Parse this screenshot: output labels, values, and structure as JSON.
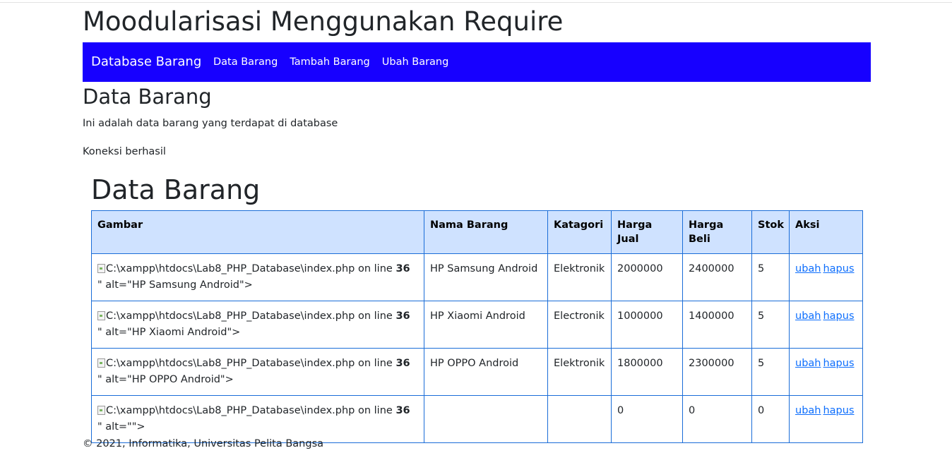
{
  "header": {
    "site_title": "Moodularisasi Menggunakan Require"
  },
  "navbar": {
    "brand": "Database Barang",
    "links": [
      {
        "label": "Data Barang"
      },
      {
        "label": "Tambah Barang"
      },
      {
        "label": "Ubah Barang"
      }
    ]
  },
  "page": {
    "section_title": "Data Barang",
    "description": "Ini adalah data barang yang terdapat di database",
    "status": "Koneksi berhasil",
    "table_title": "Data Barang"
  },
  "table": {
    "columns": [
      "Gambar",
      "Nama Barang",
      "Katagori",
      "Harga Jual",
      "Harga Beli",
      "Stok",
      "Aksi"
    ],
    "img_path_text": "C:\\xampp\\htdocs\\Lab8_PHP_Database\\index.php on line ",
    "img_line_number": "36",
    "action_edit": "ubah",
    "action_delete": "hapus",
    "rows": [
      {
        "alt_text": "\" alt=\"HP Samsung Android\">",
        "nama": "HP Samsung Android",
        "kategori": "Elektronik",
        "harga_jual": "2000000",
        "harga_beli": "2400000",
        "stok": "5"
      },
      {
        "alt_text": "\" alt=\"HP Xiaomi Android\">",
        "nama": "HP Xiaomi Android",
        "kategori": "Electronik",
        "harga_jual": "1000000",
        "harga_beli": "1400000",
        "stok": "5"
      },
      {
        "alt_text": "\" alt=\"HP OPPO Android\">",
        "nama": "HP OPPO Android",
        "kategori": "Elektronik",
        "harga_jual": "1800000",
        "harga_beli": "2300000",
        "stok": "5"
      },
      {
        "alt_text": "\" alt=\"\">",
        "nama": "",
        "kategori": "",
        "harga_jual": "0",
        "harga_beli": "0",
        "stok": "0"
      }
    ]
  },
  "footer": {
    "text": "© 2021, Informatika, Universitas Pelita Bangsa"
  },
  "colors": {
    "navbar_bg": "#1700ff",
    "table_header_bg": "#cfe2ff",
    "table_border": "#1a6dd8",
    "link": "#0d6efd"
  },
  "icons": {
    "broken_image": "broken-image-icon"
  }
}
